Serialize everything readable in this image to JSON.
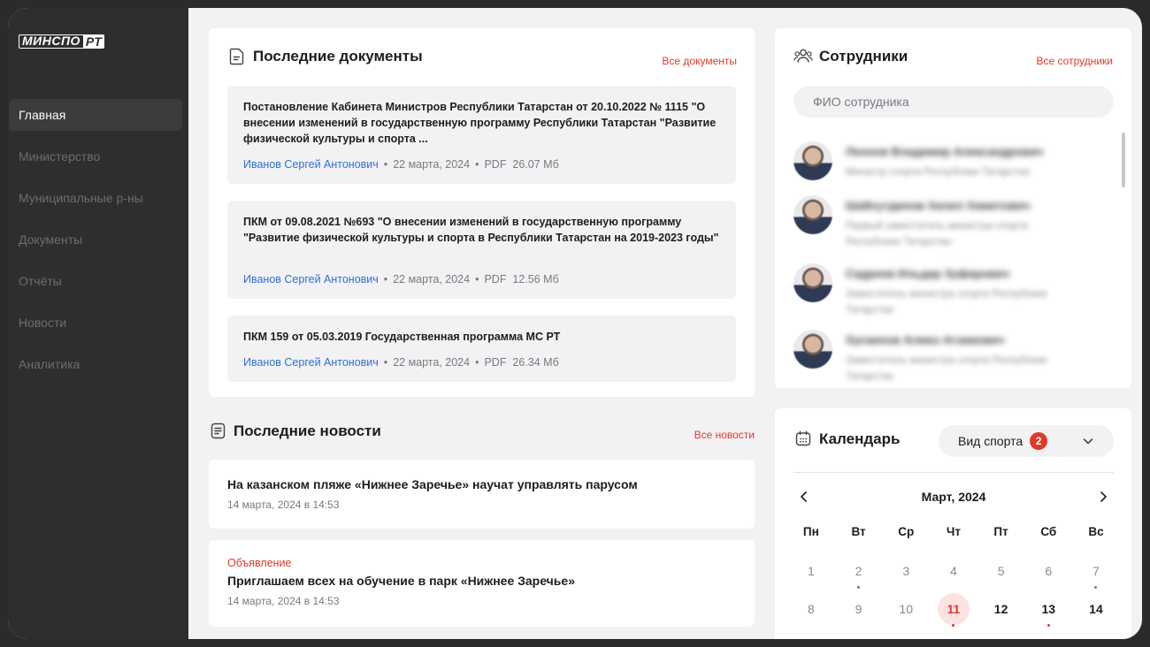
{
  "brand": {
    "part1": "МИНСПО",
    "part2": "РТ"
  },
  "nav": [
    {
      "label": "Главная",
      "active": true
    },
    {
      "label": "Министерство",
      "active": false
    },
    {
      "label": "Муниципальные р-ны",
      "active": false
    },
    {
      "label": "Документы",
      "active": false
    },
    {
      "label": "Отчёты",
      "active": false
    },
    {
      "label": "Новости",
      "active": false
    },
    {
      "label": "Аналитика",
      "active": false
    }
  ],
  "documents": {
    "title": "Последние документы",
    "all_link": "Все документы",
    "items": [
      {
        "title": "Постановление Кабинета Министров Республики Татарстан от 20.10.2022 № 1115 \"О внесении изменений в государственную программу Республики Татарстан \"Развитие физической культуры и спорта ...",
        "author": "Иванов Сергей Антонович",
        "date": "22 марта, 2024",
        "format": "PDF",
        "size": "26.07 Мб"
      },
      {
        "title": "ПКМ от 09.08.2021 №693 \"О внесении изменений в государственную программу \"Развитие физической культуры и спорта в Республики Татарстан на 2019-2023 годы\"",
        "author": "Иванов Сергей Антонович",
        "date": "22 марта, 2024",
        "format": "PDF",
        "size": "12.56 Мб"
      },
      {
        "title": "ПКМ 159 от 05.03.2019 Государственная программа МС РТ",
        "author": "Иванов Сергей Антонович",
        "date": "22 марта, 2024",
        "format": "PDF",
        "size": "26.34 Мб"
      }
    ]
  },
  "news": {
    "title": "Последние новости",
    "all_link": "Все новости",
    "items": [
      {
        "tag": "",
        "title": "На казанском пляже «Нижнее Заречье» научат управлять парусом",
        "date": "14 марта, 2024 в 14:53"
      },
      {
        "tag": "Объявление",
        "title": "Приглашаем всех на обучение в парк «Нижнее Заречье»",
        "date": "14 марта, 2024 в 14:53"
      }
    ]
  },
  "employees": {
    "title": "Сотрудники",
    "all_link": "Все сотрудники",
    "search_placeholder": "ФИО сотрудника",
    "items": [
      {
        "name": "Леонов Владимир Александрович",
        "role": "Министр спорта Республики Татарстан"
      },
      {
        "name": "Шайхутдинов Халил Хамитович",
        "role": "Первый заместитель министра спорта Республики Татарстан"
      },
      {
        "name": "Садреев Ильдар Зуфарович",
        "role": "Заместитель министра спорта Республики Татарстан"
      },
      {
        "name": "Хусаинов Алмаз Агзамович",
        "role": "Заместитель министра спорта Республики Татарстан"
      }
    ]
  },
  "calendar": {
    "title": "Календарь",
    "sport_filter": {
      "label": "Вид спорта",
      "count": "2"
    },
    "month": "Март, 2024",
    "weekdays": [
      "Пн",
      "Вт",
      "Ср",
      "Чт",
      "Пт",
      "Сб",
      "Вс"
    ],
    "weeks": [
      [
        {
          "d": "1",
          "cur": false,
          "ev": ""
        },
        {
          "d": "2",
          "cur": false,
          "ev": "grey"
        },
        {
          "d": "3",
          "cur": false,
          "ev": ""
        },
        {
          "d": "4",
          "cur": false,
          "ev": ""
        },
        {
          "d": "5",
          "cur": false,
          "ev": ""
        },
        {
          "d": "6",
          "cur": false,
          "ev": ""
        },
        {
          "d": "7",
          "cur": false,
          "ev": "grey"
        }
      ],
      [
        {
          "d": "8",
          "cur": false,
          "ev": ""
        },
        {
          "d": "9",
          "cur": false,
          "ev": ""
        },
        {
          "d": "10",
          "cur": false,
          "ev": ""
        },
        {
          "d": "11",
          "cur": true,
          "today": true,
          "ev": "red"
        },
        {
          "d": "12",
          "cur": true,
          "ev": ""
        },
        {
          "d": "13",
          "cur": true,
          "ev": "red"
        },
        {
          "d": "14",
          "cur": true,
          "ev": ""
        }
      ]
    ]
  },
  "colors": {
    "accent": "#e0382b",
    "link": "#2f6fd6",
    "sidebar": "#2e2e30"
  }
}
